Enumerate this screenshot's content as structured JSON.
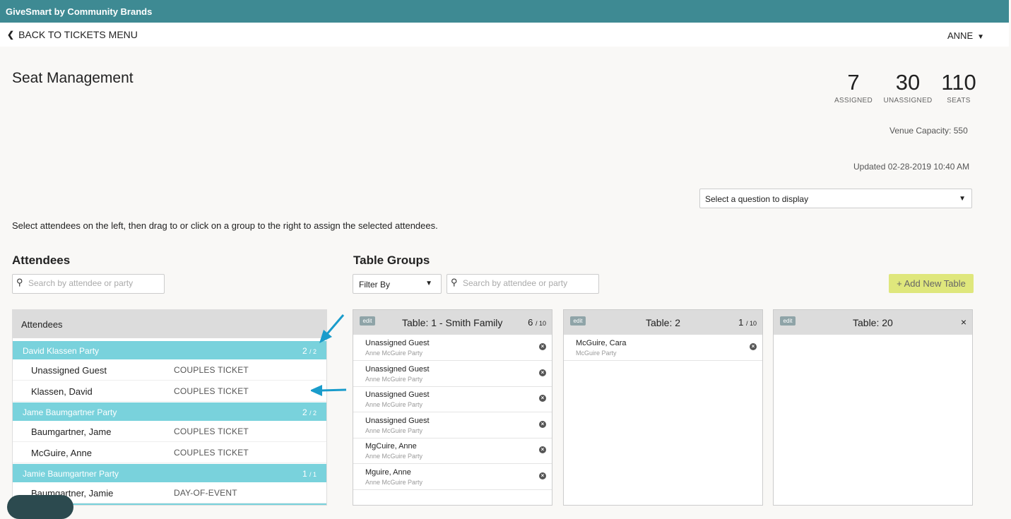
{
  "app": {
    "title": "GiveSmart by Community Brands"
  },
  "nav": {
    "back_label": "BACK TO TICKETS MENU",
    "user": "ANNE"
  },
  "page": {
    "title": "Seat Management",
    "stats": [
      {
        "value": "7",
        "label": "ASSIGNED"
      },
      {
        "value": "30",
        "label": "UNASSIGNED"
      },
      {
        "value": "110",
        "label": "SEATS"
      }
    ],
    "venue_capacity": "Venue Capacity: 550",
    "updated": "Updated 02-28-2019 10:40 AM",
    "question_select": "Select a question to display",
    "instructions": "Select attendees on the left, then drag to or click on a group to the right to assign the selected attendees."
  },
  "attendees": {
    "heading": "Attendees",
    "search_placeholder": "Search by attendee or party",
    "panel_header": "Attendees",
    "parties": [
      {
        "name": "David Klassen Party",
        "assigned": "2",
        "total": "/ 2",
        "members": [
          {
            "name": "Unassigned Guest",
            "ticket": "COUPLES TICKET"
          },
          {
            "name": "Klassen, David",
            "ticket": "COUPLES TICKET"
          }
        ]
      },
      {
        "name": "Jame Baumgartner Party",
        "assigned": "2",
        "total": "/ 2",
        "members": [
          {
            "name": "Baumgartner, Jame",
            "ticket": "COUPLES TICKET"
          },
          {
            "name": "McGuire, Anne",
            "ticket": "COUPLES TICKET"
          }
        ]
      },
      {
        "name": "Jamie Baumgartner Party",
        "assigned": "1",
        "total": "/ 1",
        "members": [
          {
            "name": "Baumgartner, Jamie",
            "ticket": "DAY-OF-EVENT"
          }
        ]
      }
    ]
  },
  "table_groups": {
    "heading": "Table Groups",
    "filter_label": "Filter By",
    "search_placeholder": "Search by attendee or party",
    "add_button": "+ Add New Table",
    "edit_label": "edit",
    "tables": [
      {
        "name": "Table: 1 - Smith Family",
        "count": "6",
        "capacity": "/ 10",
        "guests": [
          {
            "name": "Unassigned Guest",
            "party": "Anne McGuire Party"
          },
          {
            "name": "Unassigned Guest",
            "party": "Anne McGuire Party"
          },
          {
            "name": "Unassigned Guest",
            "party": "Anne McGuire Party"
          },
          {
            "name": "Unassigned Guest",
            "party": "Anne McGuire Party"
          },
          {
            "name": "MgCuire, Anne",
            "party": "Anne McGuire Party"
          },
          {
            "name": "Mguire, Anne",
            "party": "Anne McGuire Party"
          }
        ]
      },
      {
        "name": "Table: 2",
        "count": "1",
        "capacity": "/ 10",
        "guests": [
          {
            "name": "McGuire, Cara",
            "party": "McGuire Party"
          }
        ]
      },
      {
        "name": "Table: 20",
        "close": "×",
        "guests": []
      }
    ]
  },
  "colors": {
    "brand_bar": "#3e8a93",
    "party_row": "#79d2dc",
    "add_button": "#dfe77c",
    "arrow": "#1a9ccb"
  }
}
